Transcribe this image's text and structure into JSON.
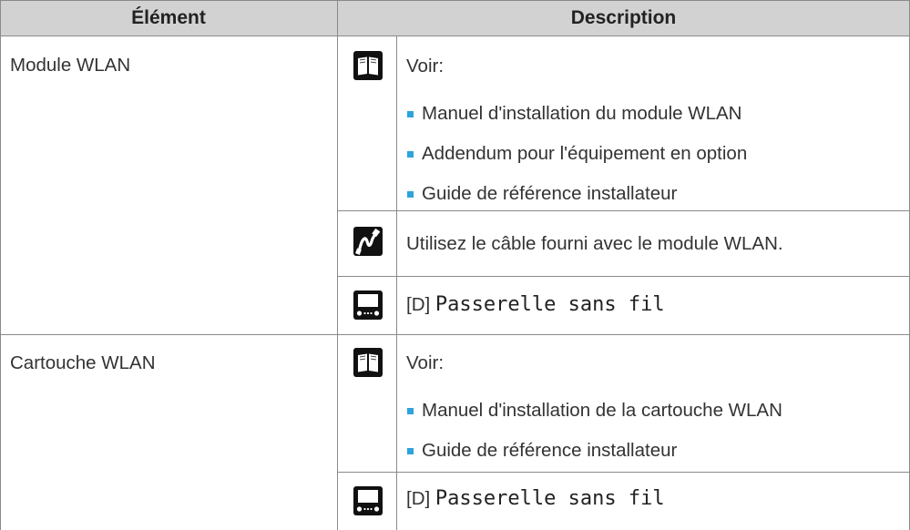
{
  "table": {
    "headers": {
      "element": "Élément",
      "description": "Description"
    },
    "accent_color": "#2ea3dc",
    "header_bg": "#d2d2d2",
    "rows": [
      {
        "element": "Module WLAN",
        "items": [
          {
            "icon": "book-icon",
            "intro": "Voir:",
            "bullets": [
              "Manuel d'installation du module WLAN",
              "Addendum pour l'équipement en option",
              "Guide de référence installateur"
            ]
          },
          {
            "icon": "cable-icon",
            "text": "Utilisez le câble fourni avec le module WLAN."
          },
          {
            "icon": "controller-icon",
            "prefix": "[D]",
            "code": "Passerelle sans fil"
          }
        ]
      },
      {
        "element": "Cartouche WLAN",
        "items": [
          {
            "icon": "book-icon",
            "intro": "Voir:",
            "bullets": [
              "Manuel d'installation de la cartouche WLAN",
              "Guide de référence installateur"
            ]
          },
          {
            "icon": "controller-icon",
            "prefix": "[D]",
            "code": "Passerelle sans fil"
          }
        ]
      }
    ]
  }
}
